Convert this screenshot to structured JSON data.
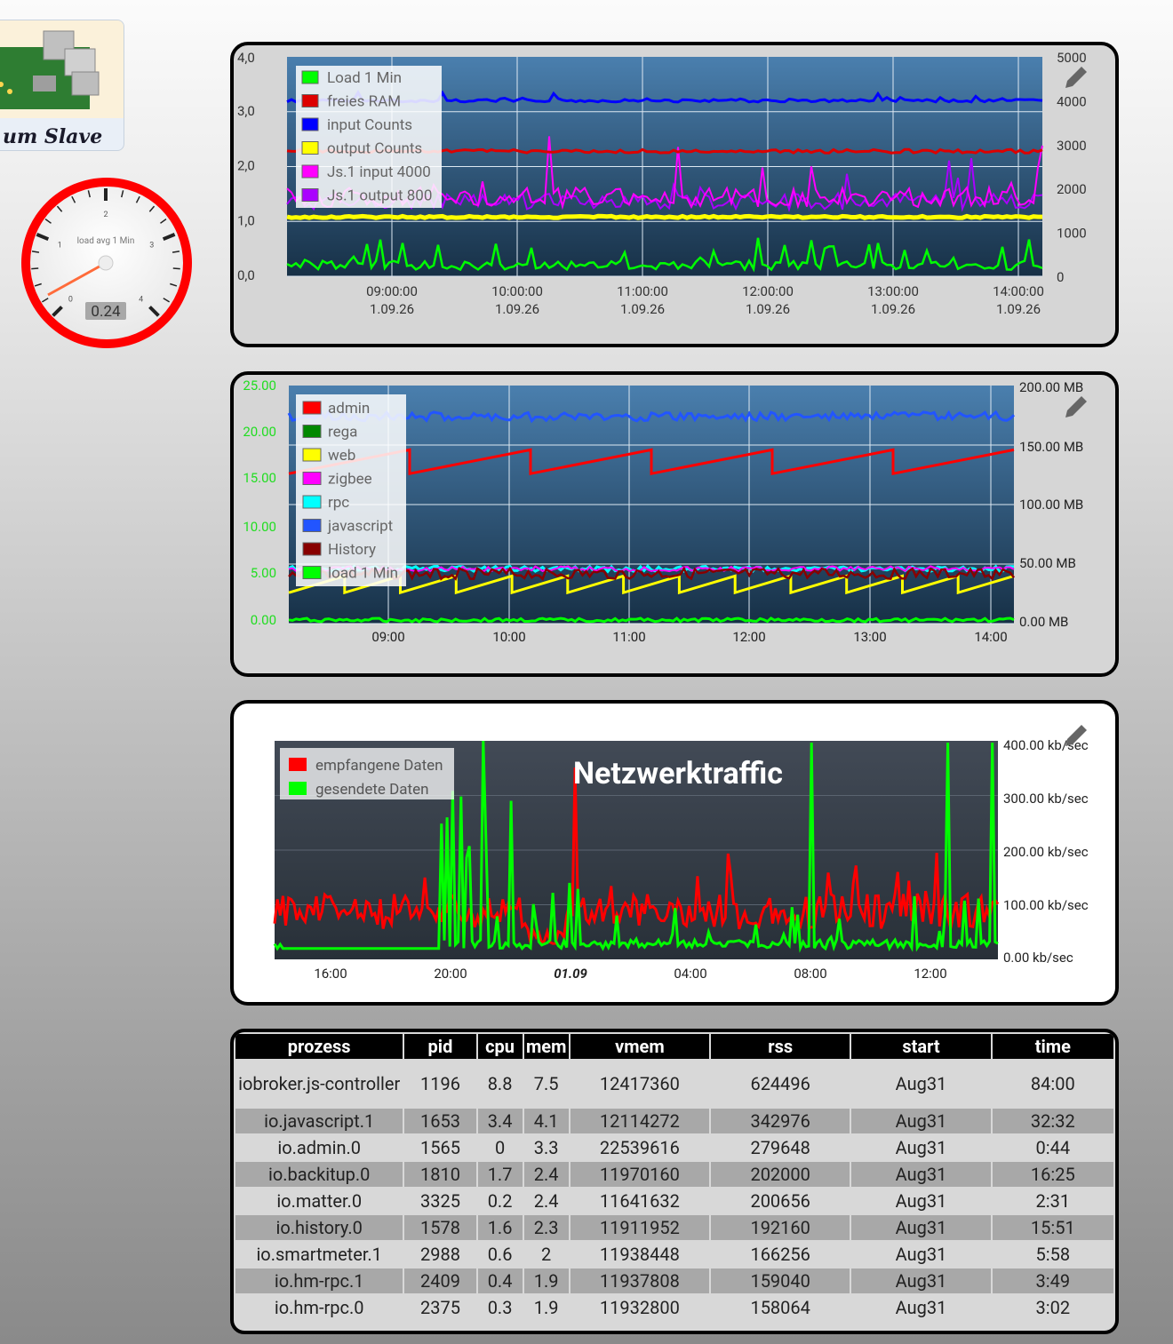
{
  "logo": {
    "text": "um Slave"
  },
  "gauge": {
    "label": "load avg 1 Min",
    "value": "0.24",
    "ticks": [
      "0",
      "1",
      "2",
      "3",
      "4"
    ]
  },
  "chart1": {
    "legend": [
      "Load 1 Min",
      "freies RAM",
      "input Counts",
      "output Counts",
      "Js.1 input 4000",
      "Js.1 output 800"
    ],
    "colors": [
      "#00ff00",
      "#dd0000",
      "#0000ff",
      "#ffff00",
      "#ff00ff",
      "#aa00ff"
    ],
    "yleft": [
      "4,0",
      "3,0",
      "2,0",
      "1,0",
      "0,0"
    ],
    "yright": [
      "5000",
      "4000",
      "3000",
      "2000",
      "1000",
      "0"
    ],
    "xticks": [
      [
        "09:00:00",
        "1.09.26"
      ],
      [
        "10:00:00",
        "1.09.26"
      ],
      [
        "11:00:00",
        "1.09.26"
      ],
      [
        "12:00:00",
        "1.09.26"
      ],
      [
        "13:00:00",
        "1.09.26"
      ],
      [
        "14:00:00",
        "1.09.26"
      ]
    ]
  },
  "chart2": {
    "legend": [
      "admin",
      "rega",
      "web",
      "zigbee",
      "rpc",
      "javascript",
      "History",
      "load 1 Min"
    ],
    "colors": [
      "#ff0000",
      "#008800",
      "#ffff00",
      "#ff00ff",
      "#00ffff",
      "#2255ff",
      "#880000",
      "#00ff00"
    ],
    "yleft": [
      "25.00",
      "20.00",
      "15.00",
      "10.00",
      "5.00",
      "0.00"
    ],
    "yright": [
      "200.00 MB",
      "150.00 MB",
      "100.00 MB",
      "50.00 MB",
      "0.00 MB"
    ],
    "xticks": [
      "09:00",
      "10:00",
      "11:00",
      "12:00",
      "13:00",
      "14:00"
    ]
  },
  "chart3": {
    "title": "Netzwerktraffic",
    "legend": [
      "empfangene Daten",
      "gesendete Daten"
    ],
    "colors": [
      "#ff0000",
      "#00ff00"
    ],
    "yright": [
      "400.00 kb/sec",
      "300.00 kb/sec",
      "200.00 kb/sec",
      "100.00 kb/sec",
      "0.00 kb/sec"
    ],
    "xticks": [
      "16:00",
      "20:00",
      "01.09",
      "04:00",
      "08:00",
      "12:00"
    ]
  },
  "table": {
    "headers": [
      "prozess",
      "pid",
      "cpu",
      "mem",
      "vmem",
      "rss",
      "start",
      "time"
    ],
    "rows": [
      [
        "iobroker.js-controller",
        "1196",
        "8.8",
        "7.5",
        "12417360",
        "624496",
        "Aug31",
        "84:00"
      ],
      [
        "io.javascript.1",
        "1653",
        "3.4",
        "4.1",
        "12114272",
        "342976",
        "Aug31",
        "32:32"
      ],
      [
        "io.admin.0",
        "1565",
        "0",
        "3.3",
        "22539616",
        "279648",
        "Aug31",
        "0:44"
      ],
      [
        "io.backitup.0",
        "1810",
        "1.7",
        "2.4",
        "11970160",
        "202000",
        "Aug31",
        "16:25"
      ],
      [
        "io.matter.0",
        "3325",
        "0.2",
        "2.4",
        "11641632",
        "200656",
        "Aug31",
        "2:31"
      ],
      [
        "io.history.0",
        "1578",
        "1.6",
        "2.3",
        "11911952",
        "192160",
        "Aug31",
        "15:51"
      ],
      [
        "io.smartmeter.1",
        "2988",
        "0.6",
        "2",
        "11938448",
        "166256",
        "Aug31",
        "5:58"
      ],
      [
        "io.hm-rpc.1",
        "2409",
        "0.4",
        "1.9",
        "11937808",
        "159040",
        "Aug31",
        "3:49"
      ],
      [
        "io.hm-rpc.0",
        "2375",
        "0.3",
        "1.9",
        "11932800",
        "158064",
        "Aug31",
        "3:02"
      ]
    ]
  }
}
